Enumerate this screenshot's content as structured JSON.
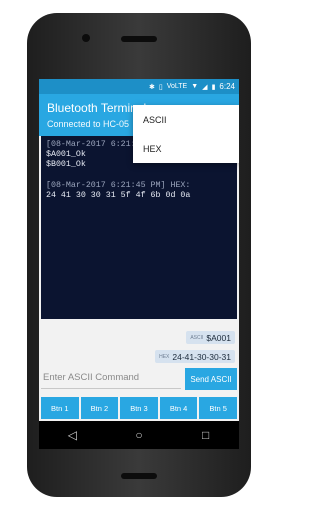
{
  "statusbar": {
    "time": "6:24",
    "network": "VoLTE"
  },
  "appbar": {
    "title": "Bluetooth Terminal",
    "subtitle": "Connected to HC-05"
  },
  "terminal": {
    "lines": [
      {
        "text": "[08-Mar-2017 6:21:17 PM] ASCII:",
        "dim": true
      },
      {
        "text": "$A001_Ok",
        "dim": false
      },
      {
        "text": "$B001_Ok",
        "dim": false
      },
      {
        "text": "",
        "dim": false
      },
      {
        "text": "[08-Mar-2017 6:21:45 PM] HEX:",
        "dim": true
      },
      {
        "text": "24 41 30 30 31 5f 4f 6b 0d 0a",
        "dim": false
      }
    ]
  },
  "sent": [
    {
      "tag": "ASCII",
      "value": "$A001"
    },
    {
      "tag": "HEX",
      "value": "24-41-30-30-31"
    }
  ],
  "input": {
    "placeholder": "Enter ASCII Command",
    "value": ""
  },
  "send_button": {
    "label": "Send ASCII"
  },
  "buttons": [
    "Btn 1",
    "Btn 2",
    "Btn 3",
    "Btn 4",
    "Btn 5"
  ],
  "menu": {
    "items": [
      "ASCII",
      "HEX"
    ]
  },
  "icons": {
    "bluetooth": "bluetooth-icon",
    "wifi": "wifi-icon",
    "signal": "signal-icon",
    "battery": "battery-icon"
  },
  "colors": {
    "accent": "#29a7e2",
    "statusbar": "#1d8fc7",
    "terminal_bg": "#0b1430"
  }
}
